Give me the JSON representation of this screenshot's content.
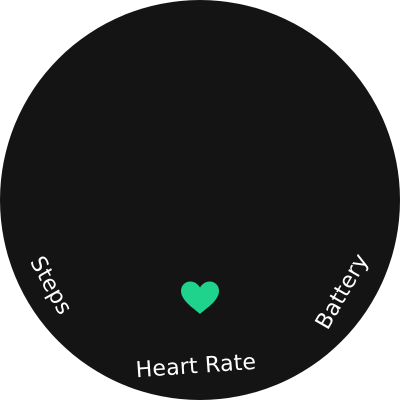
{
  "watch_face": {
    "background_color": "#141414",
    "accent_color": "#1fd38c",
    "complications": {
      "left": {
        "label": "Steps"
      },
      "bottom": {
        "label": "Heart Rate",
        "icon": "heart-icon"
      },
      "right": {
        "label": "Battery"
      }
    }
  }
}
